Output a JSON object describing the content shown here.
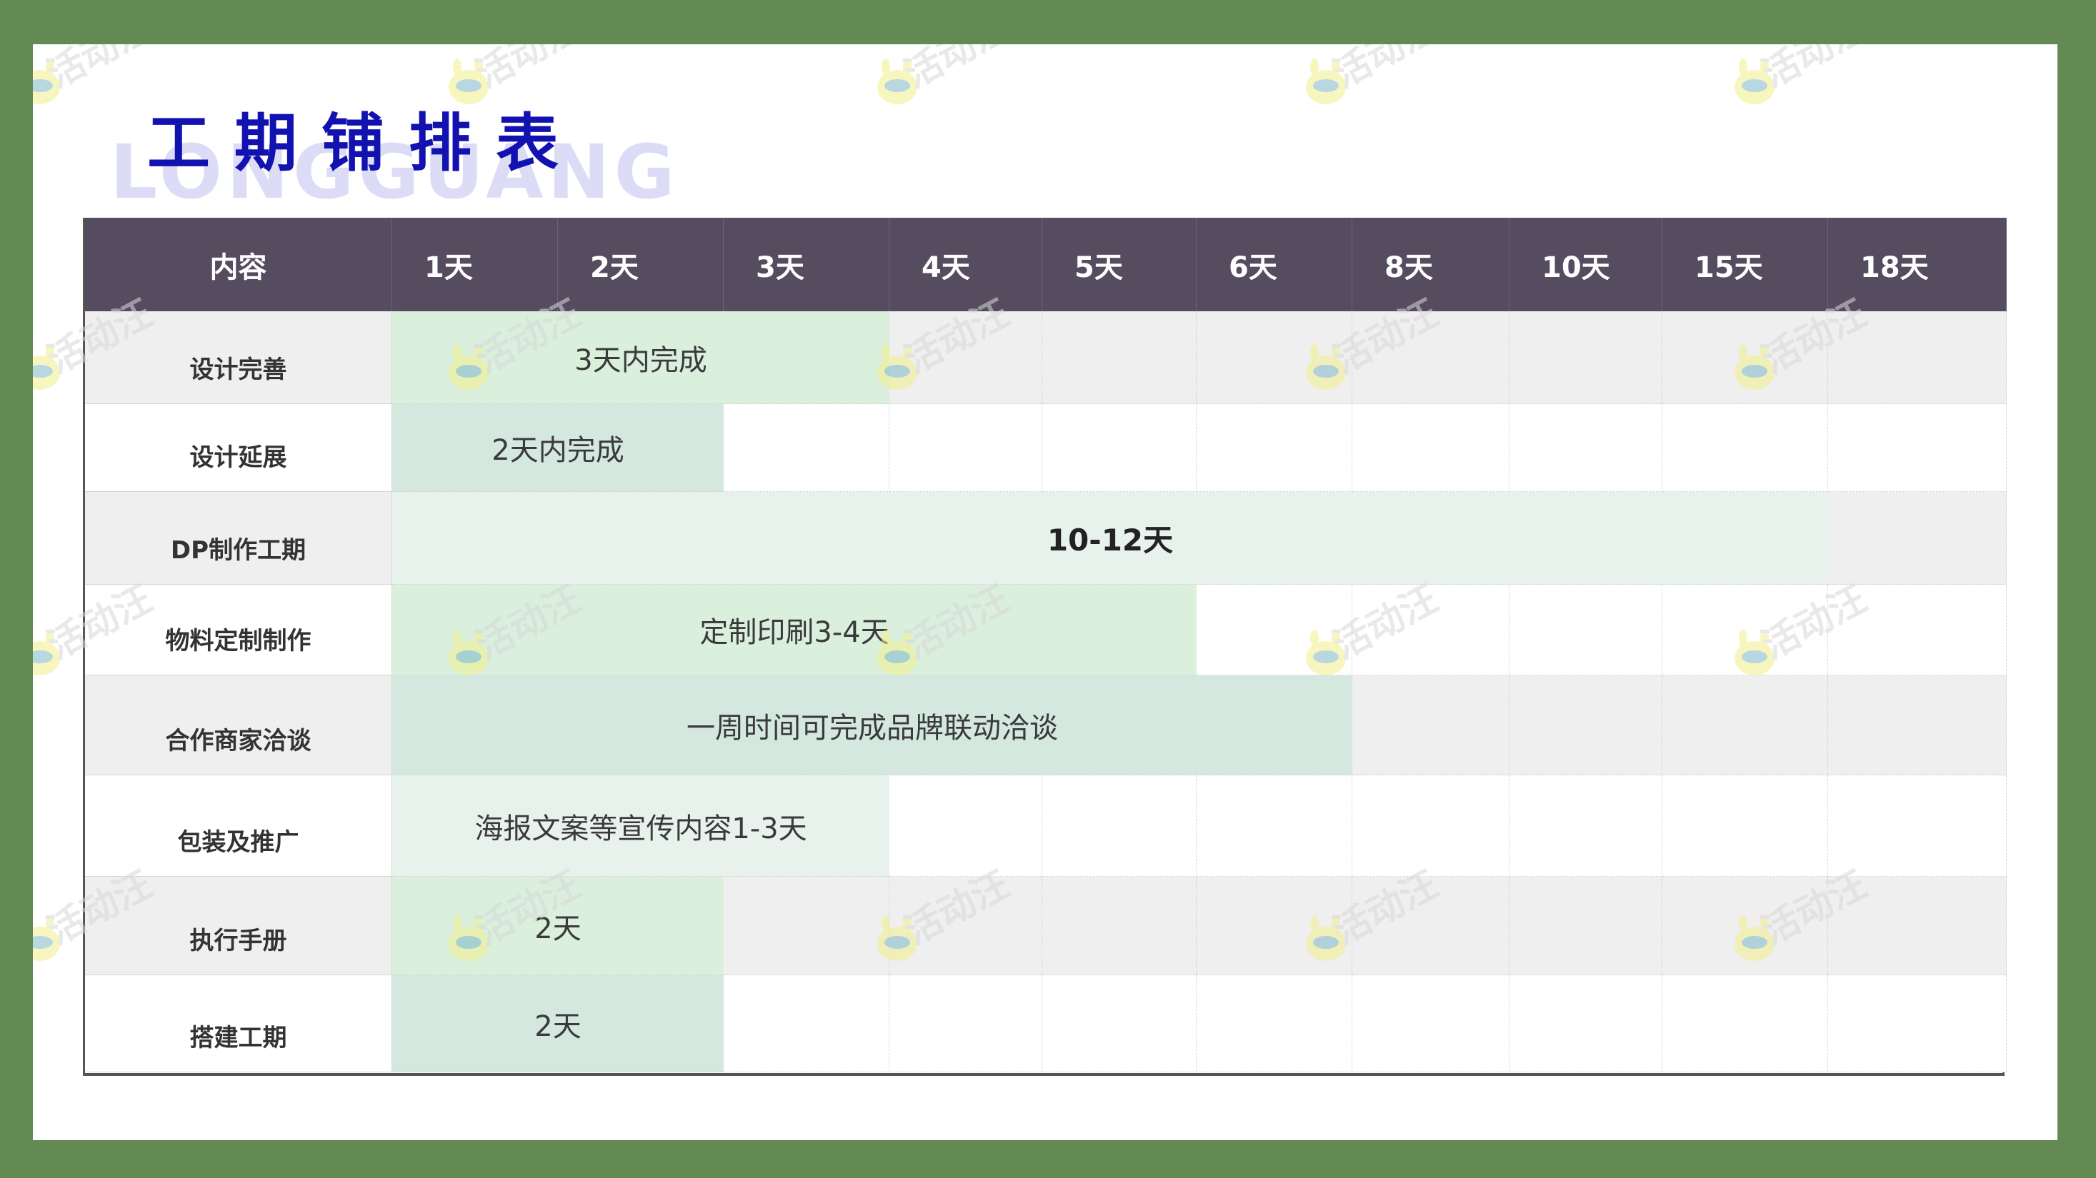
{
  "title": {
    "main": "工期铺排表",
    "background_text": "LONGGUANG"
  },
  "watermark": {
    "text": "活动汪",
    "icon": "mascot-icon"
  },
  "table": {
    "headers": [
      "内容",
      "1天",
      "2天",
      "3天",
      "4天",
      "5天",
      "6天",
      "8天",
      "10天",
      "15天",
      "18天"
    ],
    "rows": [
      {
        "label": "设计完善",
        "bar": "3天内完成",
        "span_days": 3
      },
      {
        "label": "设计延展",
        "bar": "2天内完成",
        "span_days": 2
      },
      {
        "label": "DP制作工期",
        "bar": "10-12天",
        "span_days": 9
      },
      {
        "label": "物料定制制作",
        "bar": "定制印刷3-4天",
        "span_days": 5
      },
      {
        "label": "合作商家洽谈",
        "bar": "一周时间可完成品牌联动洽谈",
        "span_days": 6
      },
      {
        "label": "包装及推广",
        "bar": "海报文案等宣传内容1-3天",
        "span_days": 3
      },
      {
        "label": "执行手册",
        "bar": "2天",
        "span_days": 2
      },
      {
        "label": "搭建工期",
        "bar": "2天",
        "span_days": 2
      }
    ]
  },
  "colors": {
    "frame": "#628a52",
    "header_bg": "#554c60",
    "title": "#1212b0",
    "bar_light_green": "#daf0dd",
    "bar_teal_green": "#d4e8e0",
    "bar_pale_green": "#e8f2ed"
  }
}
